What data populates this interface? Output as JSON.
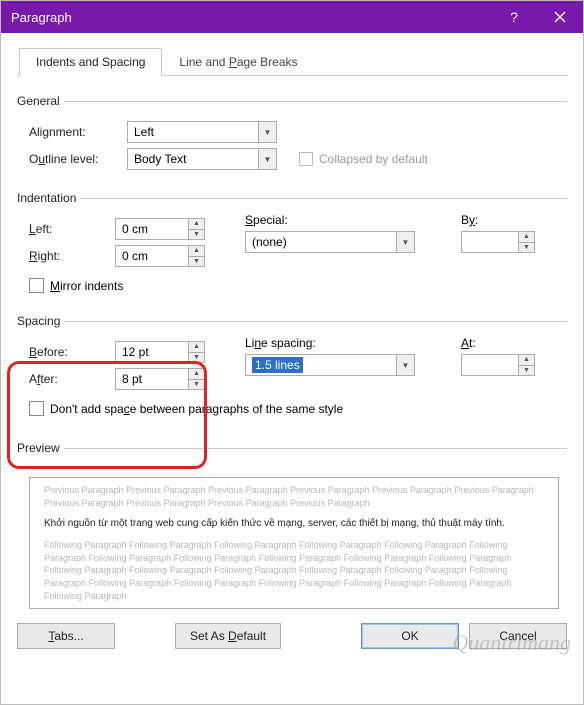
{
  "title": "Paragraph",
  "tabs": {
    "indents": "Indents and Spacing",
    "breaks_pre": "Line and ",
    "breaks_key": "P",
    "breaks_post": "age Breaks"
  },
  "general": {
    "legend": "General",
    "alignment_label": "Alignment:",
    "alignment_value": "Left",
    "outline_pre": "O",
    "outline_key": "u",
    "outline_post": "tline level:",
    "outline_value": "Body Text",
    "collapsed_label": "Collapsed by default"
  },
  "indent": {
    "legend": "Indentation",
    "left_key": "L",
    "left_post": "eft:",
    "left_value": "0 cm",
    "right_key": "R",
    "right_post": "ight:",
    "right_value": "0 cm",
    "special_key": "S",
    "special_post": "pecial:",
    "special_value": "(none)",
    "by_pre": "B",
    "by_key": "y",
    "by_post": ":",
    "mirror_key": "M",
    "mirror_post": "irror indents"
  },
  "spacing": {
    "legend": "Spacing",
    "before_key": "B",
    "before_post": "efore:",
    "before_value": "12 pt",
    "after_pre": "A",
    "after_key": "f",
    "after_post": "ter:",
    "after_value": "8 pt",
    "line_pre": "Li",
    "line_key": "n",
    "line_post": "e spacing:",
    "line_value": "1.5 lines",
    "at_key": "A",
    "at_post": "t:",
    "noadd_pre": "Don't add spa",
    "noadd_key": "c",
    "noadd_post": "e between paragraphs of the same style"
  },
  "preview": {
    "legend": "Preview",
    "prev_line": "Previous Paragraph Previous Paragraph Previous Paragraph Previous Paragraph Previous Paragraph Previous Paragraph Previous Paragraph Previous Paragraph Previous Paragraph Previous Paragraph",
    "sample": "Khởi nguồn từ một trang web cung cấp kiến thức về mạng, server, các thiết bị mạng, thủ thuật máy tính.",
    "next_line": "Following Paragraph Following Paragraph Following Paragraph Following Paragraph Following Paragraph Following Paragraph Following Paragraph Following Paragraph Following Paragraph Following Paragraph Following Paragraph Following Paragraph Following Paragraph Following Paragraph Following Paragraph Following Paragraph Following Paragraph Following Paragraph Following Paragraph Following Paragraph Following Paragraph Following Paragraph Following Paragraph"
  },
  "buttons": {
    "tabs_key": "T",
    "tabs_post": "abs...",
    "default_pre": "Set As ",
    "default_key": "D",
    "default_post": "efault",
    "ok": "OK",
    "cancel": "Cancel"
  },
  "watermark": "Quantrimang"
}
